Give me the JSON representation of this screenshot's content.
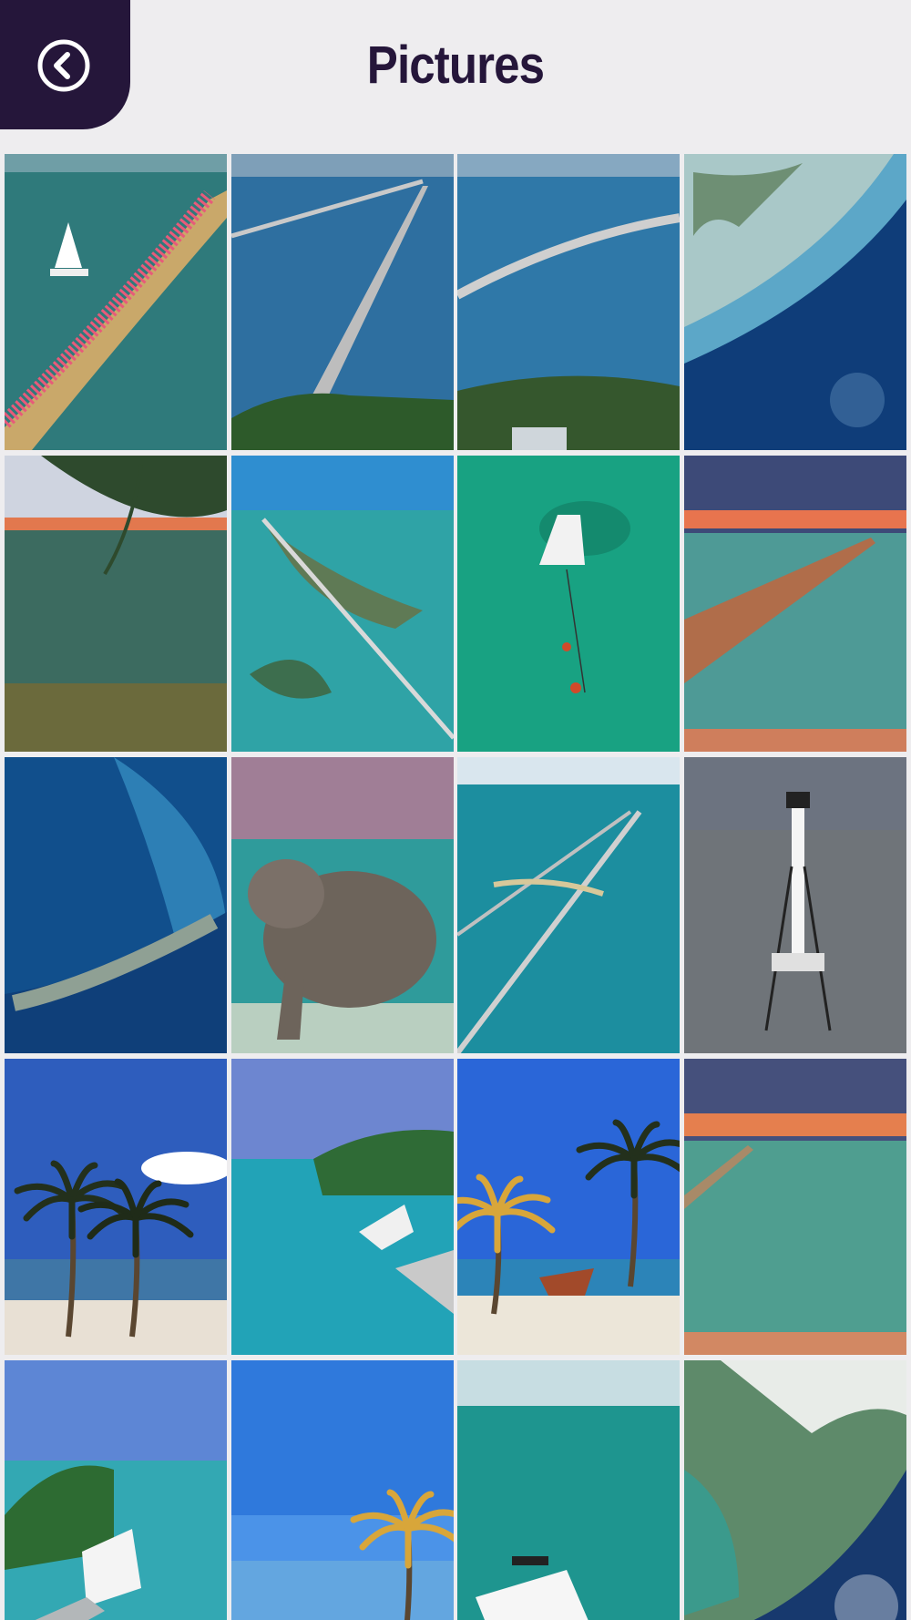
{
  "header": {
    "title": "Pictures",
    "back_icon": "back-arrow-circle-icon",
    "accent_color": "#25163a",
    "background_color": "#eeedef"
  },
  "gallery": {
    "columns": 4,
    "photos": [
      {
        "scene": "bridge-marathon"
      },
      {
        "scene": "seven-mile-bridge"
      },
      {
        "scene": "bridge-curve"
      },
      {
        "scene": "aerial-coast"
      },
      {
        "scene": "pine-sunset"
      },
      {
        "scene": "aerial-island-road"
      },
      {
        "scene": "boat-snorkelers"
      },
      {
        "scene": "pier-sunset"
      },
      {
        "scene": "aerial-keys-satellite"
      },
      {
        "scene": "manatee"
      },
      {
        "scene": "twin-bridges"
      },
      {
        "scene": "lighthouse"
      },
      {
        "scene": "palms-beach"
      },
      {
        "scene": "marina-boat"
      },
      {
        "scene": "palm-rowboat"
      },
      {
        "scene": "pier-sunset-2"
      },
      {
        "scene": "marina-yacht"
      },
      {
        "scene": "single-palm"
      },
      {
        "scene": "speedboat"
      },
      {
        "scene": "satellite-florida"
      }
    ]
  }
}
